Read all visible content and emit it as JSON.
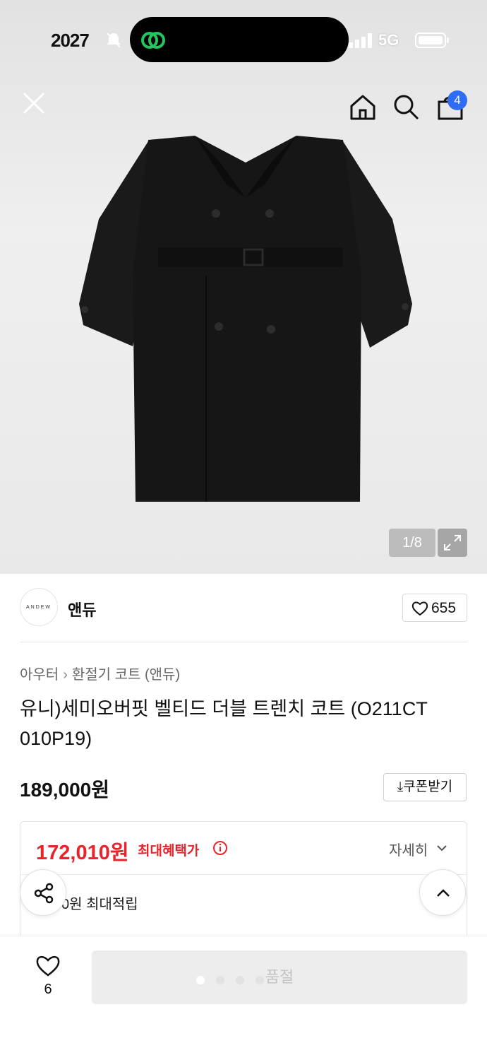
{
  "status_bar": {
    "time": "2027",
    "network": "5G"
  },
  "product_image": {
    "counter": "1/8"
  },
  "header": {
    "cart_count": "4"
  },
  "brand": {
    "logo_text": "ANDEW",
    "name": "앤듀",
    "like_count": "655"
  },
  "product": {
    "breadcrumb": [
      "아우터",
      "환절기 코트 (앤듀)"
    ],
    "title": "유니)세미오버핏 벨티드 더블 트렌치 코트 (O211CT 010P19)",
    "price": "189,000원",
    "coupon_label": "쿠폰받기"
  },
  "benefit": {
    "sale_price": "172,010원",
    "sale_label": "최대혜택가",
    "details_label": "자세히",
    "points_text": "0원 최대적립"
  },
  "bottom_bar": {
    "wish_count": "6",
    "soldout_label": "품절"
  },
  "colors": {
    "accent_red": "#e8232c",
    "badge_blue": "#2d6cf5"
  }
}
